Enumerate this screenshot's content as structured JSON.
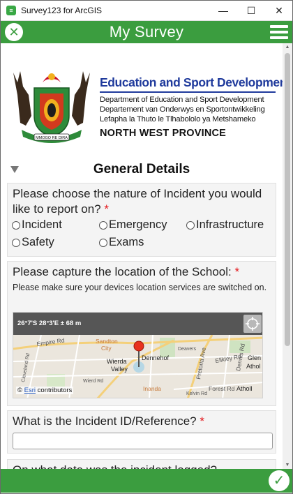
{
  "window": {
    "title": "Survey123 for ArcGIS",
    "app_icon_glyph": "≡",
    "minimize": "—",
    "maximize": "☐",
    "close": "✕"
  },
  "header": {
    "title": "My Survey",
    "close_glyph": "✕",
    "color": "#3b9d3f"
  },
  "banner": {
    "org_title": "Education and Sport Development",
    "lines": [
      "Department of Education and Sport Development",
      "Departement van Onderwys en Sportontwikkeling",
      "Lefapha la Thuto le Tlhabololo ya Metshameko"
    ],
    "province": "NORTH WEST PROVINCE",
    "crest_motto": "MMOGO RE DIRA"
  },
  "section": {
    "title": "General Details"
  },
  "questions": {
    "incident_type": {
      "label": "Please choose the nature of Incident you would like to report on?",
      "required_mark": "*",
      "options": [
        "Incident",
        "Emergency",
        "Infrastructure",
        "Safety",
        "Exams"
      ]
    },
    "location": {
      "label": "Please capture the location of the School:",
      "required_mark": "*",
      "hint": "Please make sure your devices location services are switched on.",
      "coords": "26°7'S 28°3'E ± 68 m",
      "attribution_prefix": "©",
      "attribution_link": "Esri",
      "attribution_suffix": "contributors",
      "map_labels": {
        "sandton": "Sandton",
        "city": "City",
        "wierda": "Wierda",
        "valley": "Valley",
        "dennehof": "Dennehof",
        "inanda": "Inanda",
        "atholl": "Atholl",
        "glen": "Glen",
        "athol": "Athol",
        "empire_rd": "Empire Rd",
        "pretoria_ave": "Pretoria Ave",
        "ellkley_rd": "Ellkley Rd",
        "dennis_rd": "Dennis Rd",
        "kelvin_rd": "Kelvin Rd",
        "forest_rd": "Forest Rd",
        "cleveland_rd": "Cleveland Rd",
        "wierd_rd": "Wierd Rd",
        "deavers": "Deavers"
      }
    },
    "incident_id": {
      "label": "What is the Incident ID/Reference?",
      "required_mark": "*",
      "value": ""
    },
    "date_logged": {
      "label": "On what date was the incident logged?"
    }
  },
  "footer": {
    "submit_glyph": "✓"
  }
}
